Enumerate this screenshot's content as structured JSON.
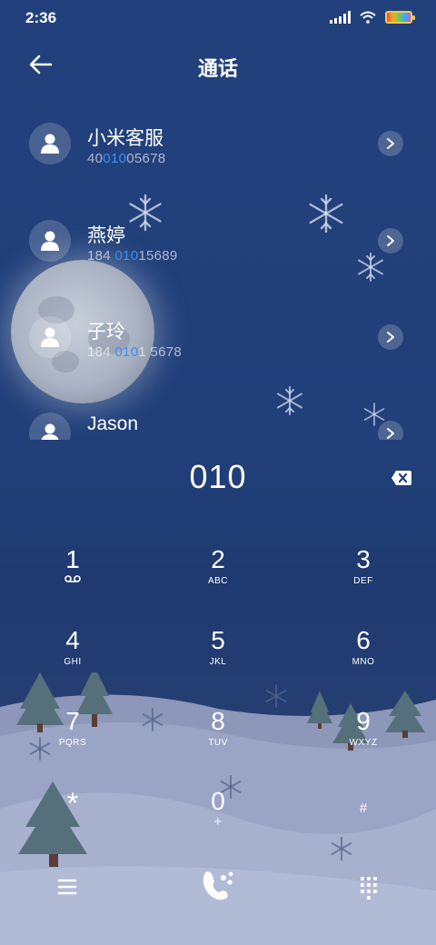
{
  "status_bar": {
    "time": "2:36"
  },
  "header": {
    "title": "通话"
  },
  "contacts": [
    {
      "name": "小米客服",
      "number_pre": "40",
      "number_hl": "010",
      "number_post": "05678"
    },
    {
      "name": "燕婷",
      "number_pre": "184 ",
      "number_hl": "010",
      "number_post": "15689"
    },
    {
      "name": "子玲",
      "number_pre": "184 ",
      "number_hl": "010",
      "number_post": "1 5678"
    },
    {
      "name": "Jason",
      "number_pre": "",
      "number_hl": "",
      "number_post": ""
    }
  ],
  "dialer": {
    "input": "010",
    "keys": [
      {
        "num": "1",
        "letters": ""
      },
      {
        "num": "2",
        "letters": "ABC"
      },
      {
        "num": "3",
        "letters": "DEF"
      },
      {
        "num": "4",
        "letters": "GHI"
      },
      {
        "num": "5",
        "letters": "JKL"
      },
      {
        "num": "6",
        "letters": "MNO"
      },
      {
        "num": "7",
        "letters": "PQRS"
      },
      {
        "num": "8",
        "letters": "TUV"
      },
      {
        "num": "9",
        "letters": "WXYZ"
      },
      {
        "num": "*",
        "letters": ""
      },
      {
        "num": "0",
        "letters": "+"
      },
      {
        "num": "#",
        "letters": ""
      }
    ]
  },
  "icons": {
    "back": "back-arrow-icon",
    "delete": "backspace-icon",
    "menu": "menu-icon",
    "call": "call-icon",
    "keypad": "keypad-icon",
    "voicemail": "voicemail-icon"
  },
  "colors": {
    "highlight": "#3d8ef0",
    "background": "#22417c"
  }
}
